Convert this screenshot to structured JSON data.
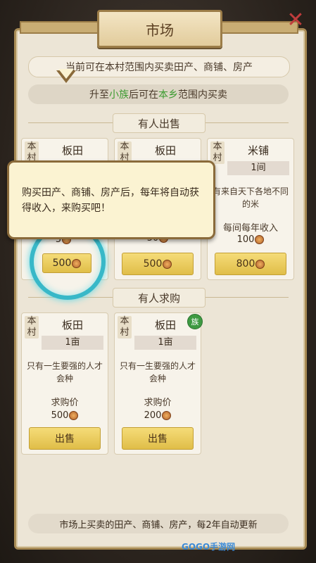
{
  "title": "市场",
  "notice": "当前可在本村范围内买卖田产、商铺、房产",
  "upgrade": {
    "prefix": "升至",
    "rank": "小族",
    "middle": "后可在",
    "scope": "本乡",
    "suffix": "范围内买卖"
  },
  "sections": {
    "sell": "有人出售",
    "buy": "有人求购"
  },
  "sell_items": [
    {
      "village": "本村",
      "name": "板田",
      "price_label": "",
      "price": "5",
      "button": "500"
    },
    {
      "village": "本村",
      "name": "板田",
      "price_label": "",
      "price": "50",
      "button": "500"
    },
    {
      "village": "本村",
      "name": "米铺",
      "qty": "1间",
      "desc": "有来自天下各地不同的米",
      "price_label": "每间每年收入",
      "price": "100",
      "button": "800"
    }
  ],
  "buy_items": [
    {
      "village": "本村",
      "name": "板田",
      "qty": "1亩",
      "desc": "只有一生要强的人才会种",
      "price_label": "求购价",
      "price": "500",
      "button": "出售"
    },
    {
      "village": "本村",
      "name": "板田",
      "qty": "1亩",
      "desc": "只有一生要强的人才会种",
      "price_label": "求购价",
      "price": "200",
      "button": "出售",
      "badge": "族"
    }
  ],
  "tooltip": "购买田产、商铺、房产后，每年将自动获得收入，来购买吧！",
  "footer": "市场上买卖的田产、商铺、房产，每2年自动更新",
  "watermark": "GOGO手游网",
  "colors": {
    "accent": "#38b8c8",
    "button": "#e0be48",
    "highlight": "#3b9b30"
  }
}
